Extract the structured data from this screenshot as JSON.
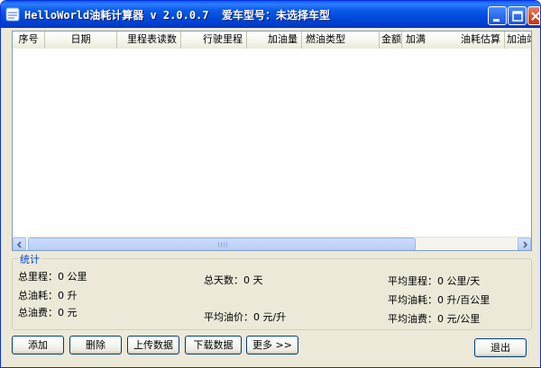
{
  "window": {
    "title": "HelloWorld油耗计算器 v 2.0.0.7  爱车型号：未选择车型"
  },
  "table": {
    "columns": [
      "序号",
      "日期",
      "里程表读数",
      "行驶里程",
      "加油量",
      "燃油类型",
      "金额",
      "加满",
      "油耗估算",
      "加油站"
    ]
  },
  "stats": {
    "title": "统计",
    "total_mileage": "总里程：0 公里",
    "total_days": "总天数：0 天",
    "avg_mileage": "平均里程：0 公里/天",
    "total_fuel": "总油耗：0 升",
    "avg_fuel": "平均油耗：0 升/百公里",
    "total_cost": "总油费：0 元",
    "avg_price": "平均油价：0 元/升",
    "avg_cost": "平均油费：0 元/公里"
  },
  "buttons": {
    "add": "添加",
    "delete": "删除",
    "upload": "上传数据",
    "download": "下载数据",
    "more": "更多 >>",
    "exit": "退出"
  },
  "icons": {
    "app": "app-icon",
    "minimize": "minimize-icon",
    "maximize": "maximize-icon",
    "close": "close-icon",
    "scroll_left": "chevron-left-icon",
    "scroll_right": "chevron-right-icon"
  },
  "colors": {
    "titlebar": "#0054e3",
    "window_bg": "#ece9d8",
    "group_title": "#0046d5",
    "close_button": "#d9512c"
  }
}
